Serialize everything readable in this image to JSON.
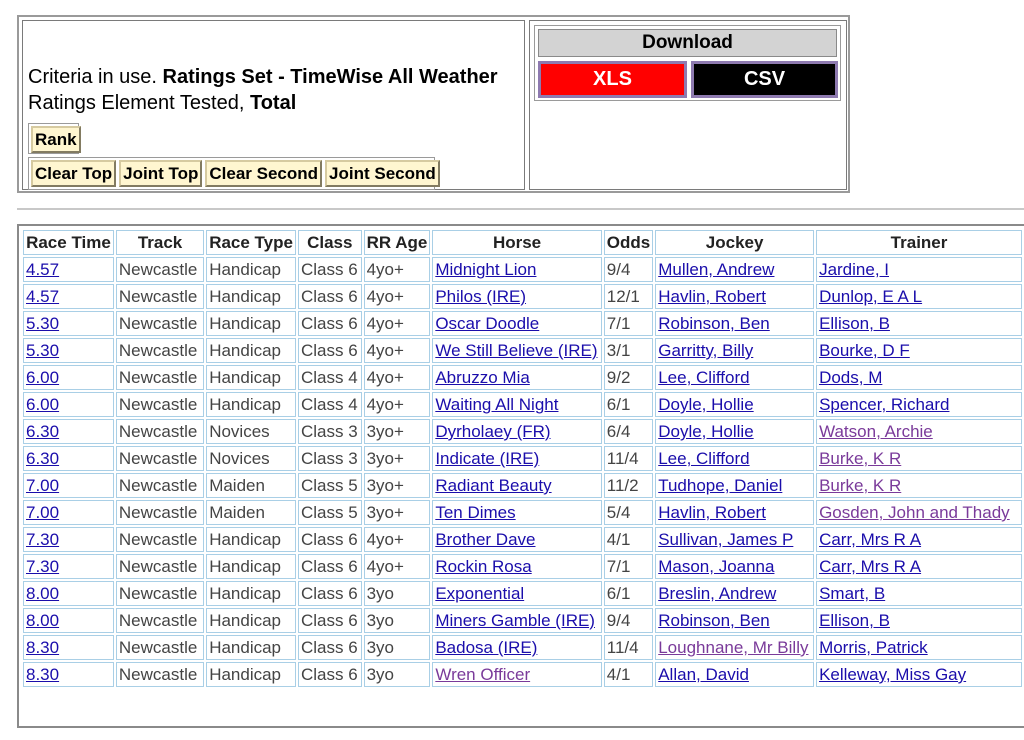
{
  "criteria": {
    "prefix": "Criteria in use.",
    "set": "Ratings Set - TimeWise All Weather",
    "element_prefix": "Ratings Element Tested,",
    "element": "Total"
  },
  "buttons": {
    "rank": "Rank",
    "clear_top": "Clear Top",
    "joint_top": "Joint Top",
    "clear_second": "Clear Second",
    "joint_second": "Joint Second"
  },
  "download": {
    "title": "Download",
    "xls": "XLS",
    "csv": "CSV",
    "xls_color": "#ff0000",
    "csv_color": "#000000"
  },
  "table": {
    "columns": [
      "Race Time",
      "Track",
      "Race Type",
      "Class",
      "RR Age",
      "Horse",
      "Odds",
      "Jockey",
      "Trainer"
    ],
    "rows": [
      {
        "time": "4.57",
        "track": "Newcastle",
        "type": "Handicap",
        "class": "Class 6",
        "age": "4yo+",
        "horse": "Midnight Lion",
        "odds": "9/4",
        "jockey": "Mullen, Andrew",
        "trainer": "Jardine, I"
      },
      {
        "time": "4.57",
        "track": "Newcastle",
        "type": "Handicap",
        "class": "Class 6",
        "age": "4yo+",
        "horse": "Philos (IRE)",
        "odds": "12/1",
        "jockey": "Havlin, Robert",
        "trainer": "Dunlop, E A L"
      },
      {
        "time": "5.30",
        "track": "Newcastle",
        "type": "Handicap",
        "class": "Class 6",
        "age": "4yo+",
        "horse": "Oscar Doodle",
        "odds": "7/1",
        "jockey": "Robinson, Ben",
        "trainer": "Ellison, B"
      },
      {
        "time": "5.30",
        "track": "Newcastle",
        "type": "Handicap",
        "class": "Class 6",
        "age": "4yo+",
        "horse": "We Still Believe (IRE)",
        "odds": "3/1",
        "jockey": "Garritty, Billy",
        "trainer": "Bourke, D F"
      },
      {
        "time": "6.00",
        "track": "Newcastle",
        "type": "Handicap",
        "class": "Class 4",
        "age": "4yo+",
        "horse": "Abruzzo Mia",
        "odds": "9/2",
        "jockey": "Lee, Clifford",
        "trainer": "Dods, M"
      },
      {
        "time": "6.00",
        "track": "Newcastle",
        "type": "Handicap",
        "class": "Class 4",
        "age": "4yo+",
        "horse": "Waiting All Night",
        "odds": "6/1",
        "jockey": "Doyle, Hollie",
        "trainer": "Spencer, Richard"
      },
      {
        "time": "6.30",
        "track": "Newcastle",
        "type": "Novices",
        "class": "Class 3",
        "age": "3yo+",
        "horse": "Dyrholaey (FR)",
        "odds": "6/4",
        "jockey": "Doyle, Hollie",
        "trainer": "Watson, Archie",
        "trainer_visited": true
      },
      {
        "time": "6.30",
        "track": "Newcastle",
        "type": "Novices",
        "class": "Class 3",
        "age": "3yo+",
        "horse": "Indicate (IRE)",
        "odds": "11/4",
        "jockey": "Lee, Clifford",
        "trainer": "Burke, K R",
        "trainer_visited": true
      },
      {
        "time": "7.00",
        "track": "Newcastle",
        "type": "Maiden",
        "class": "Class 5",
        "age": "3yo+",
        "horse": "Radiant Beauty",
        "odds": "11/2",
        "jockey": "Tudhope, Daniel",
        "trainer": "Burke, K R",
        "trainer_visited": true
      },
      {
        "time": "7.00",
        "track": "Newcastle",
        "type": "Maiden",
        "class": "Class 5",
        "age": "3yo+",
        "horse": "Ten Dimes",
        "odds": "5/4",
        "jockey": "Havlin, Robert",
        "trainer": "Gosden, John and Thady",
        "trainer_visited": true
      },
      {
        "time": "7.30",
        "track": "Newcastle",
        "type": "Handicap",
        "class": "Class 6",
        "age": "4yo+",
        "horse": "Brother Dave",
        "odds": "4/1",
        "jockey": "Sullivan, James P",
        "trainer": "Carr, Mrs R A"
      },
      {
        "time": "7.30",
        "track": "Newcastle",
        "type": "Handicap",
        "class": "Class 6",
        "age": "4yo+",
        "horse": "Rockin Rosa",
        "odds": "7/1",
        "jockey": "Mason, Joanna",
        "trainer": "Carr, Mrs R A"
      },
      {
        "time": "8.00",
        "track": "Newcastle",
        "type": "Handicap",
        "class": "Class 6",
        "age": "3yo",
        "horse": "Exponential",
        "odds": "6/1",
        "jockey": "Breslin, Andrew",
        "trainer": "Smart, B"
      },
      {
        "time": "8.00",
        "track": "Newcastle",
        "type": "Handicap",
        "class": "Class 6",
        "age": "3yo",
        "horse": "Miners Gamble (IRE)",
        "odds": "9/4",
        "jockey": "Robinson, Ben",
        "trainer": "Ellison, B"
      },
      {
        "time": "8.30",
        "track": "Newcastle",
        "type": "Handicap",
        "class": "Class 6",
        "age": "3yo",
        "horse": "Badosa (IRE)",
        "odds": "11/4",
        "jockey": "Loughnane, Mr Billy",
        "trainer": "Morris, Patrick",
        "jockey_visited": true
      },
      {
        "time": "8.30",
        "track": "Newcastle",
        "type": "Handicap",
        "class": "Class 6",
        "age": "3yo",
        "horse": "Wren Officer",
        "odds": "4/1",
        "jockey": "Allan, David",
        "trainer": "Kelleway, Miss Gay",
        "horse_visited": true
      }
    ]
  }
}
